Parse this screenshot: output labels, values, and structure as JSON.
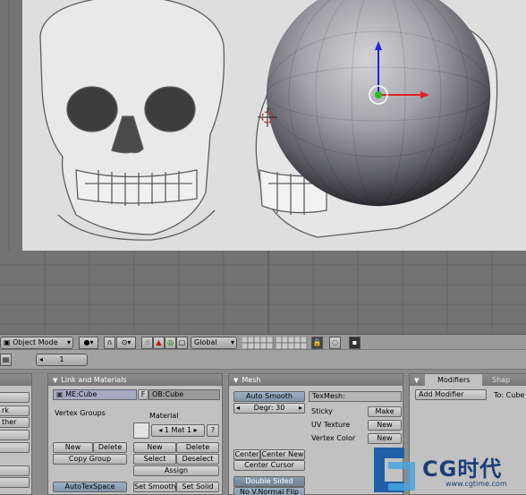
{
  "viewport_header": {
    "mode": "Object Mode",
    "orientation": "Global"
  },
  "buttons_header": {
    "frame": "1"
  },
  "left_panel": {
    "item_1": "rk",
    "item_2": "ther"
  },
  "link_materials": {
    "title": "Link and Materials",
    "mesh_name": "ME:Cube",
    "fake_user": "F",
    "object_name": "OB:Cube",
    "vertex_groups_label": "Vertex Groups",
    "material_label": "Material",
    "material_slot": "1 Mat 1",
    "material_help": "?",
    "vg_new": "New",
    "vg_delete": "Delete",
    "copy_group": "Copy Group",
    "mat_new": "New",
    "mat_delete": "Delete",
    "select": "Select",
    "deselect": "Deselect",
    "assign": "Assign",
    "autotexspace": "AutoTexSpace",
    "set_smooth": "Set Smooth",
    "set_solid": "Set Solid"
  },
  "mesh_panel": {
    "title": "Mesh",
    "auto_smooth": "Auto Smooth",
    "degr": "Degr: 30",
    "texmesh": "TexMesh:",
    "sticky_label": "Sticky",
    "sticky_btn": "Make",
    "uv_label": "UV Texture",
    "uv_btn": "New",
    "vcol_label": "Vertex Color",
    "vcol_btn": "New",
    "center": "Center",
    "center_new": "Center New",
    "center_cursor": "Center Cursor",
    "double_sided": "Double Sided",
    "no_vnormal_flip": "No V.Normal Flip"
  },
  "modifiers_panel": {
    "tab_modifiers": "Modifiers",
    "tab_shapes": "Shap",
    "add_modifier": "Add Modifier",
    "to_label": "To: Cube"
  },
  "watermark": {
    "brand": "CG时代",
    "url": "www.cgtime.com"
  }
}
